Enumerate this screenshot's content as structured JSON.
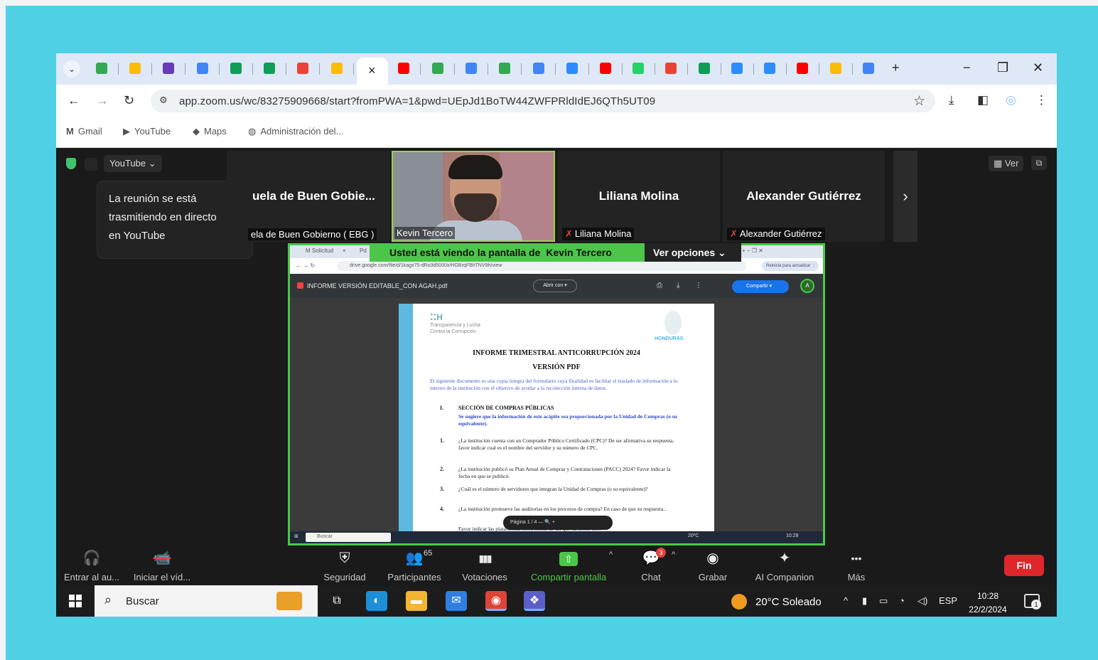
{
  "browser": {
    "tab_drop": "⌄",
    "active_tab_close": "×",
    "new_tab": "+",
    "tabs": [
      {
        "icon": "google-drive-icon",
        "color": "#34a853"
      },
      {
        "icon": "google-drive-icon",
        "color": "#fbbc04"
      },
      {
        "icon": "google-forms-icon",
        "color": "#673ab7"
      },
      {
        "icon": "google-docs-icon",
        "color": "#4285f4"
      },
      {
        "icon": "google-sheets-icon",
        "color": "#0f9d58"
      },
      {
        "icon": "google-sheets-icon",
        "color": "#0f9d58"
      },
      {
        "icon": "gmail-icon",
        "color": "#ea4335"
      },
      {
        "icon": "google-drive-icon",
        "color": "#fbbc04"
      },
      {
        "icon": "youtube-icon",
        "color": "#ff0000"
      },
      {
        "icon": "google-drive-icon",
        "color": "#34a853"
      },
      {
        "icon": "google-docs-icon",
        "color": "#4285f4"
      },
      {
        "icon": "google-drive-icon",
        "color": "#34a853"
      },
      {
        "icon": "google-docs-icon",
        "color": "#4285f4"
      },
      {
        "icon": "zoom-icon",
        "color": "#2d8cff"
      },
      {
        "icon": "youtube-icon",
        "color": "#ff0000"
      },
      {
        "icon": "whatsapp-icon",
        "color": "#25d366"
      },
      {
        "icon": "gmail-icon",
        "color": "#ea4335"
      },
      {
        "icon": "google-sheets-icon",
        "color": "#0f9d58"
      },
      {
        "icon": "zoom-icon",
        "color": "#2d8cff"
      },
      {
        "icon": "zoom-icon",
        "color": "#2d8cff"
      },
      {
        "icon": "youtube-icon",
        "color": "#ff0000"
      },
      {
        "icon": "google-drive-icon",
        "color": "#fbbc04"
      },
      {
        "icon": "google-docs-icon",
        "color": "#4285f4"
      }
    ],
    "window_controls": {
      "minimize": "−",
      "restore": "❐",
      "close": "✕"
    },
    "nav": {
      "back": "←",
      "forward": "→",
      "reload": "↻"
    },
    "url": "app.zoom.us/wc/83275909668/start?fromPWA=1&pwd=UEpJd1BoTW44ZWFPRldIdEJ6QTh5UT09",
    "site_info_icon": "⚙",
    "star": "☆",
    "toolbar_icons": {
      "download": "⤓",
      "sidepanel": "◧",
      "profile": "◎",
      "menu": "⋮"
    },
    "bookmarks": [
      {
        "icon": "gmail-icon",
        "glyph": "M",
        "color": "#ea4335",
        "label": "Gmail"
      },
      {
        "icon": "youtube-icon",
        "glyph": "▶",
        "color": "#ff0000",
        "label": "YouTube"
      },
      {
        "icon": "maps-icon",
        "glyph": "◆",
        "color": "#34a853",
        "label": "Maps"
      },
      {
        "icon": "globe-icon",
        "glyph": "◍",
        "color": "#444444",
        "label": "Administración del..."
      }
    ]
  },
  "zoom": {
    "livestream_dropdown": "YouTube ⌄",
    "tooltip": {
      "line1": "La reunión se está",
      "line2": "trasmitiendo en directo",
      "line3": "en YouTube"
    },
    "tiles": [
      {
        "big": "uela de Buen Gobie...",
        "small": "ela de Buen Gobierno ( EBG )",
        "muted": false
      },
      {
        "big": "Liliana Molina",
        "small": "Liliana Molina",
        "muted": true
      },
      {
        "big": "Alexander Gutiérrez",
        "small": "Alexander Gutiérrez",
        "muted": true
      }
    ],
    "speaker_name": "Kevin Tercero",
    "next_arrow": "›",
    "view_button": "▦ Ver",
    "popout": "⧉",
    "share_banner": {
      "prefix": "Usted está viendo la pantalla de",
      "name": "Kevin Tercero"
    },
    "view_options": "Ver opciones ⌄",
    "mic_glyph": "✗"
  },
  "shared_screen": {
    "tabs": [
      "M Solicitud",
      "×",
      "Pd"
    ],
    "tab_controls": "+     −     ❐     ✕",
    "url": "drive.google.com/file/d/1kagx75-dRo3d5000x/HGBrqFBhTNV9h/view",
    "pill": "Reinicia para actualizar  ⋮",
    "pdf_name": "INFORME VERSIÓN EDITABLE_CON AGAH.pdf",
    "open_with": "Abrir con ▾",
    "share": "Compartir ▾",
    "avatar": "A",
    "logo_lh": "⁚⁚H",
    "logo_sub": "Transparencia y Lucha Contra la Corrupción",
    "logo_country": "HONDURAS",
    "title1": "INFORME TRIMESTRAL ANTICORRUPCIÓN 2024",
    "title2": "VERSIÓN PDF",
    "intro": "El siguiente documento es una copia íntegra del formulario cuya finalidad es facilitar el traslado de información a lo interno de la institución con el objetivo de ayudar a la recolección interna de datos.",
    "section_num": "I.",
    "section_title": "SECCIÓN DE COMPRAS PÚBLICAS",
    "section_note": "Se sugiere que la información de este acápite sea proporcionada por la Unidad de Compras (o su equivalente).",
    "questions": [
      {
        "n": "1.",
        "text": "¿La institución cuenta con un Comprador Público Certificado (CPC)? De ser afirmativa su respuesta, favor indicar cual es el nombre del servidor y su número de CPC."
      },
      {
        "n": "2.",
        "text": "¿La institución publicó su Plan Anual de Compras y Contrataciones (PACC) 2024? Favor indicar la fecha en que se publicó."
      },
      {
        "n": "3.",
        "text": "¿Cuál es el número de servidores que integran la Unidad de Compras (o su equivalente)?"
      },
      {
        "n": "4.",
        "text": "¿La institución promueve las auditorías en los procesos de compra? En caso de que su respuesta..."
      }
    ],
    "footer_line": "Favor indicar las plataformas electrónicas de las que ha hecho uso.",
    "page_bar": "Página   1   /   4    —   🔍   +",
    "taskbar_search": "Buscar",
    "taskbar_weather": "20ºC",
    "taskbar_clock": "10:28"
  },
  "controls": {
    "audio": {
      "icon": "headphones-icon",
      "glyph": "🎧",
      "label": "Entrar al au..."
    },
    "video": {
      "icon": "video-off-icon",
      "glyph": "📹",
      "label": "Iniciar el víd..."
    },
    "security": {
      "icon": "shield-icon",
      "glyph": "⛨",
      "label": "Seguridad"
    },
    "participants": {
      "icon": "participants-icon",
      "glyph": "👥",
      "label": "Participantes",
      "count": "65"
    },
    "polls": {
      "icon": "polls-icon",
      "glyph": "▮▮▮",
      "label": "Votaciones"
    },
    "share": {
      "icon": "share-screen-icon",
      "glyph": "⇧",
      "label": "Compartir pantalla"
    },
    "chat": {
      "icon": "chat-icon",
      "glyph": "💬",
      "label": "Chat",
      "badge": "3"
    },
    "record": {
      "icon": "record-icon",
      "glyph": "◉",
      "label": "Grabar"
    },
    "ai": {
      "icon": "ai-companion-icon",
      "glyph": "✦",
      "label": "AI Companion"
    },
    "more": {
      "icon": "more-icon",
      "glyph": "•••",
      "label": "Más"
    },
    "caret": "^",
    "end": "Fin"
  },
  "taskbar": {
    "search": "Buscar",
    "weather": "20°C  Soleado",
    "lang": "ESP",
    "time": "10:28",
    "date": "22/2/2024",
    "notif_count": "1",
    "tray_caret": "^",
    "apps": [
      {
        "icon": "task-view-icon",
        "glyph": "⧉",
        "color": "#1c1c1c"
      },
      {
        "icon": "edge-icon",
        "glyph": "◐",
        "color": "#1d8fd8"
      },
      {
        "icon": "file-explorer-icon",
        "glyph": "▬",
        "color": "#f2b632"
      },
      {
        "icon": "mail-icon",
        "glyph": "✉",
        "color": "#2f7fe0"
      },
      {
        "icon": "chrome-icon",
        "glyph": "◉",
        "color": "#db4437"
      },
      {
        "icon": "teams-icon",
        "glyph": "❖",
        "color": "#5b5fc7"
      }
    ]
  }
}
